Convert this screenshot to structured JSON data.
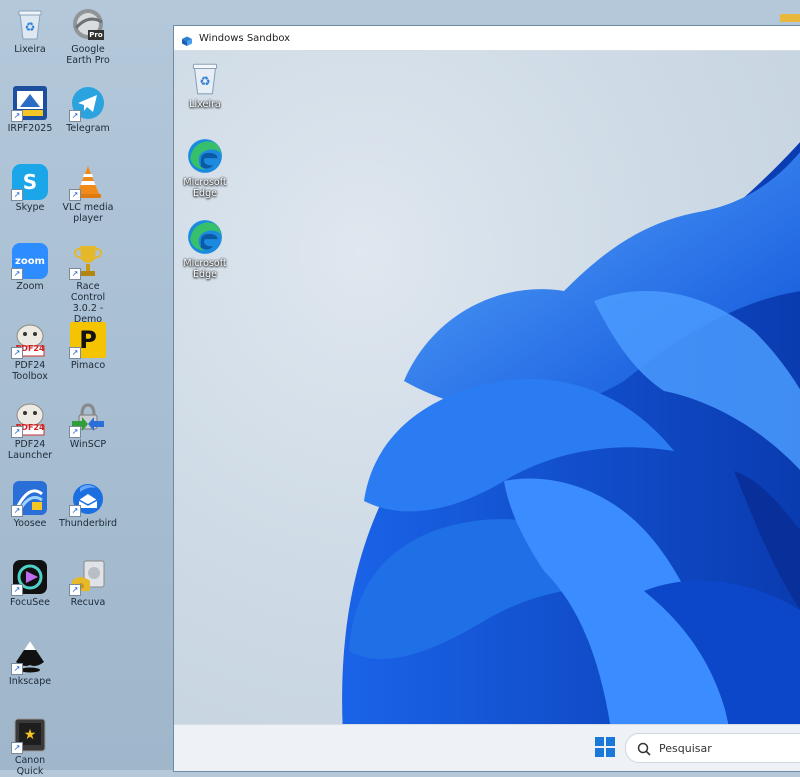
{
  "desktop": {
    "icons": [
      {
        "label": "Lixeira",
        "icon": "recycle-bin-icon"
      },
      {
        "label": "Google Earth Pro",
        "icon": "google-earth-icon",
        "badge": "Pro"
      },
      {
        "label": "IRPF2025",
        "icon": "irpf-icon"
      },
      {
        "label": "Telegram",
        "icon": "telegram-icon"
      },
      {
        "label": "Skype",
        "icon": "skype-icon",
        "glyph": "S"
      },
      {
        "label": "VLC media player",
        "icon": "vlc-icon"
      },
      {
        "label": "Zoom",
        "icon": "zoom-icon",
        "glyph": "zoom"
      },
      {
        "label": "Race Control 3.0.2 - Demo",
        "icon": "trophy-icon"
      },
      {
        "label": "PDF24 Toolbox",
        "icon": "pdf24-icon",
        "glyph": "PDF24"
      },
      {
        "label": "Pimaco",
        "icon": "pimaco-icon",
        "glyph": "P"
      },
      {
        "label": "PDF24 Launcher",
        "icon": "pdf24-icon",
        "glyph": "PDF24"
      },
      {
        "label": "WinSCP",
        "icon": "winscp-icon"
      },
      {
        "label": "Yoosee",
        "icon": "yoosee-icon"
      },
      {
        "label": "Thunderbird",
        "icon": "thunderbird-icon"
      },
      {
        "label": "FocuSee",
        "icon": "focusee-icon"
      },
      {
        "label": "Recuva",
        "icon": "recuva-icon"
      },
      {
        "label": "Inkscape",
        "icon": "inkscape-icon"
      },
      {
        "label": "Canon Quick",
        "icon": "canon-icon"
      }
    ]
  },
  "sandbox": {
    "title": "Windows Sandbox",
    "icons": [
      {
        "label": "Lixeira",
        "icon": "recycle-bin-icon"
      },
      {
        "label": "Microsoft Edge",
        "icon": "edge-icon"
      },
      {
        "label": "Microsoft Edge",
        "icon": "edge-icon"
      }
    ],
    "taskbar": {
      "search_placeholder": "Pesquisar"
    }
  },
  "colors": {
    "host_wallpaper": "#a9bfd3",
    "bloom_blue": "#1f6fe6",
    "taskbar": "#eef1f5",
    "start_blue": "#1a78d8"
  }
}
